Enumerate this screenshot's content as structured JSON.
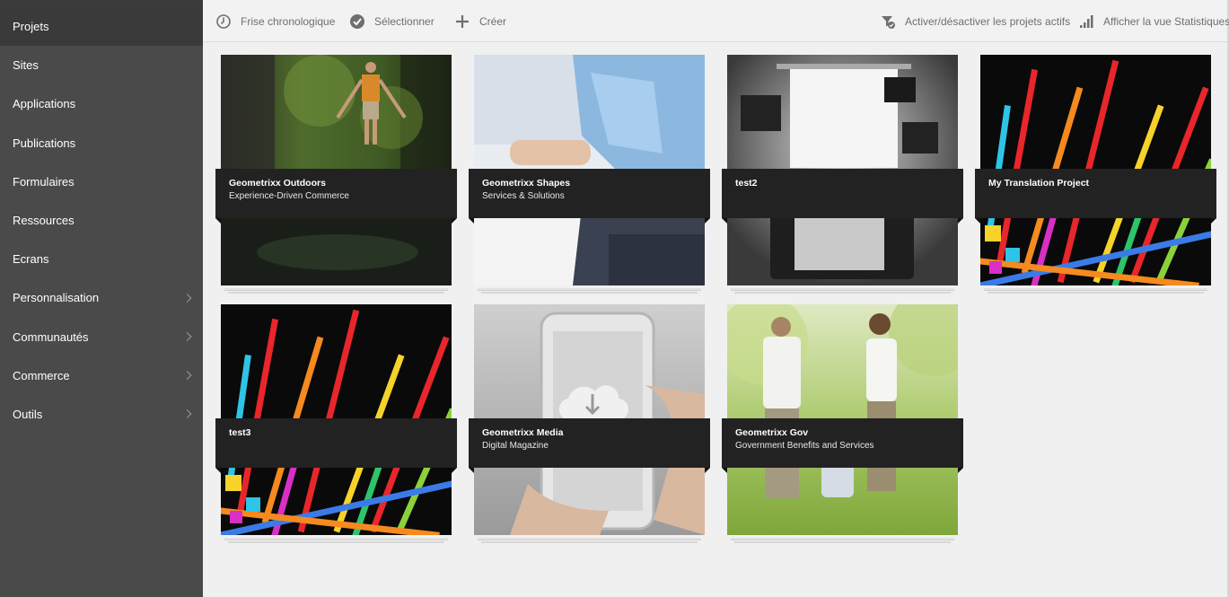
{
  "sidebar": {
    "items": [
      {
        "label": "Projets",
        "active": true,
        "has_children": false
      },
      {
        "label": "Sites",
        "has_children": false
      },
      {
        "label": "Applications",
        "has_children": false
      },
      {
        "label": "Publications",
        "has_children": false
      },
      {
        "label": "Formulaires",
        "has_children": false
      },
      {
        "label": "Ressources",
        "has_children": false
      },
      {
        "label": "Ecrans",
        "has_children": false
      },
      {
        "label": "Personnalisation",
        "has_children": true
      },
      {
        "label": "Communautés",
        "has_children": true
      },
      {
        "label": "Commerce",
        "has_children": true
      },
      {
        "label": "Outils",
        "has_children": true
      }
    ]
  },
  "toolbar": {
    "timeline_label": "Frise chronologique",
    "select_label": "Sélectionner",
    "create_label": "Créer",
    "toggle_active_label": "Activer/désactiver les projets actifs",
    "stats_label": "Afficher la vue Statistiques"
  },
  "projects": [
    {
      "title": "Geometrixx Outdoors",
      "subtitle": "Experience-Driven Commerce",
      "thumbnail": "hiker-in-gorge"
    },
    {
      "title": "Geometrixx Shapes",
      "subtitle": "Services & Solutions",
      "thumbnail": "person-with-laptop"
    },
    {
      "title": "test2",
      "subtitle": "",
      "thumbnail": "camera-studio"
    },
    {
      "title": "My Translation Project",
      "subtitle": "",
      "thumbnail": "colorful-light-streaks"
    },
    {
      "title": "test3",
      "subtitle": "",
      "thumbnail": "colorful-light-streaks"
    },
    {
      "title": "Geometrixx Media",
      "subtitle": "Digital Magazine",
      "thumbnail": "transparent-phone"
    },
    {
      "title": "Geometrixx Gov",
      "subtitle": "Government Benefits and Services",
      "thumbnail": "couple-walking-in-field"
    }
  ],
  "colors": {
    "sidebar_bg": "#4a4a4a",
    "sidebar_active": "#3a3a3a",
    "content_bg": "#f0f0f0",
    "label_bg": "#222222",
    "toolbar_text": "#6e6e6e"
  }
}
